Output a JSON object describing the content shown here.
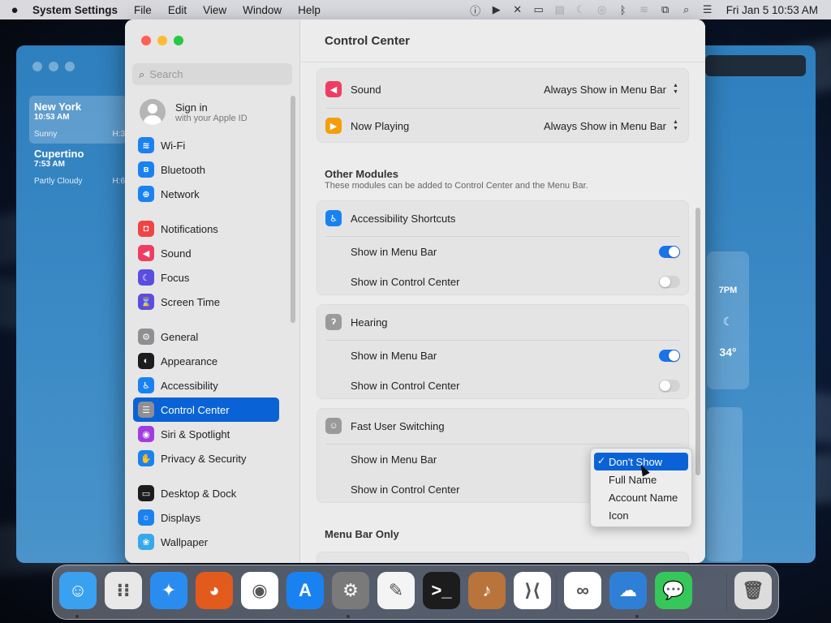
{
  "menubar": {
    "app_name": "System Settings",
    "menus": [
      "File",
      "Edit",
      "View",
      "Window",
      "Help"
    ],
    "clock": "Fri Jan 5  10:53 AM"
  },
  "weather": {
    "cities": [
      {
        "name": "New York",
        "time": "10:53 AM",
        "condition": "Sunny",
        "hilo": "H:3"
      },
      {
        "name": "Cupertino",
        "time": "7:53 AM",
        "condition": "Partly Cloudy",
        "hilo": "H:6"
      }
    ],
    "hour_label": "7PM",
    "hour_temp": "34°"
  },
  "sidebar": {
    "search_placeholder": "Search",
    "signin_title": "Sign in",
    "signin_subtitle": "with your Apple ID",
    "items": [
      {
        "label": "Wi-Fi",
        "color": "#1a82f0",
        "glyph": "≋"
      },
      {
        "label": "Bluetooth",
        "color": "#1a82f0",
        "glyph": "ʙ"
      },
      {
        "label": "Network",
        "color": "#1a82f0",
        "glyph": "⊕"
      },
      {
        "label": "Notifications",
        "color": "#ef4444",
        "glyph": "◘"
      },
      {
        "label": "Sound",
        "color": "#ef3d62",
        "glyph": "◀"
      },
      {
        "label": "Focus",
        "color": "#5b4de0",
        "glyph": "☾"
      },
      {
        "label": "Screen Time",
        "color": "#5b4de0",
        "glyph": "⌛"
      },
      {
        "label": "General",
        "color": "#8e8e93",
        "glyph": "⚙"
      },
      {
        "label": "Appearance",
        "color": "#1c1c1e",
        "glyph": "◐"
      },
      {
        "label": "Accessibility",
        "color": "#1a82f0",
        "glyph": "♿"
      },
      {
        "label": "Control Center",
        "color": "#8e8e93",
        "glyph": "☰"
      },
      {
        "label": "Siri & Spotlight",
        "color": "#a03ce0",
        "glyph": "◉"
      },
      {
        "label": "Privacy & Security",
        "color": "#1a82f0",
        "glyph": "✋"
      },
      {
        "label": "Desktop & Dock",
        "color": "#1c1c1e",
        "glyph": "▭"
      },
      {
        "label": "Displays",
        "color": "#1a82f0",
        "glyph": "☼"
      },
      {
        "label": "Wallpaper",
        "color": "#38a8e8",
        "glyph": "❀"
      }
    ],
    "selected": "Control Center"
  },
  "main": {
    "title": "Control Center",
    "top_rows": [
      {
        "label": "Sound",
        "value": "Always Show in Menu Bar",
        "color": "#ef3d62"
      },
      {
        "label": "Now Playing",
        "value": "Always Show in Menu Bar",
        "color": "#f59e0b"
      }
    ],
    "other_modules_title": "Other Modules",
    "other_modules_subtitle": "These modules can be added to Control Center and the Menu Bar.",
    "accessibility": {
      "title": "Accessibility Shortcuts",
      "show_menu_bar": "Show in Menu Bar",
      "show_control_center": "Show in Control Center"
    },
    "hearing": {
      "title": "Hearing",
      "show_menu_bar": "Show in Menu Bar",
      "show_control_center": "Show in Control Center"
    },
    "fast_user": {
      "title": "Fast User Switching",
      "show_menu_bar": "Show in Menu Bar",
      "show_control_center": "Show in Control Center"
    },
    "menu_bar_only": "Menu Bar Only"
  },
  "dropdown": {
    "options": [
      "Don't Show",
      "Full Name",
      "Account Name",
      "Icon"
    ],
    "selected": "Don't Show"
  },
  "dock": {
    "apps": [
      {
        "name": "Finder",
        "color": "#3aa0f0",
        "glyph": "☺"
      },
      {
        "name": "Launchpad",
        "color": "#e8e8e8",
        "glyph": "⁝⁝"
      },
      {
        "name": "Safari",
        "color": "#2b8cf0",
        "glyph": "✦"
      },
      {
        "name": "Firefox",
        "color": "#e25b1c",
        "glyph": "◕"
      },
      {
        "name": "Chrome",
        "color": "#ffffff",
        "glyph": "◉"
      },
      {
        "name": "App Store",
        "color": "#1a82f0",
        "glyph": "A"
      },
      {
        "name": "System Settings",
        "color": "#7a7a7a",
        "glyph": "⚙"
      },
      {
        "name": "TextEdit",
        "color": "#f4f4f4",
        "glyph": "✎"
      },
      {
        "name": "Terminal",
        "color": "#1c1c1c",
        "glyph": ">_"
      },
      {
        "name": "Instruments",
        "color": "#b8743a",
        "glyph": "♪"
      },
      {
        "name": "VS Code",
        "color": "#ffffff",
        "glyph": "⟩⟨"
      },
      {
        "name": "Visual Studio",
        "color": "#ffffff",
        "glyph": "∞"
      },
      {
        "name": "Weather",
        "color": "#2f7fd6",
        "glyph": "☁"
      },
      {
        "name": "Messages",
        "color": "#35c759",
        "glyph": "💬"
      },
      {
        "name": "Trash",
        "color": "#dcdcdc",
        "glyph": "🗑"
      }
    ]
  }
}
